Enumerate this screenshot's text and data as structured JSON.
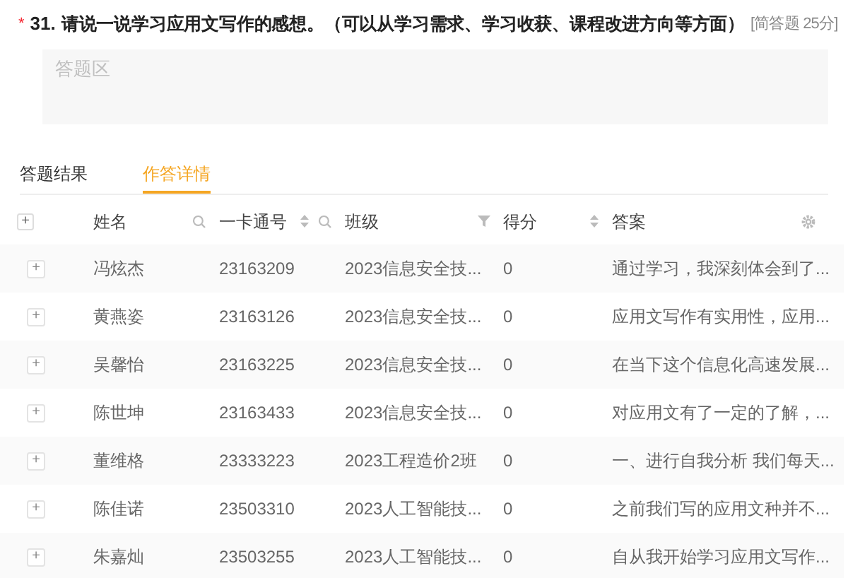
{
  "question": {
    "required_mark": "*",
    "number": "31.",
    "text": "请说一说学习应用文写作的感想。（可以从学习需求、学习收获、课程改进方向等方面）",
    "meta": "[简答题 25分]"
  },
  "answer_box": {
    "placeholder": "答题区"
  },
  "tabs": [
    {
      "label": "答题结果",
      "selected": false
    },
    {
      "label": "作答详情",
      "selected": true
    }
  ],
  "table": {
    "expand_all": "+",
    "columns": [
      {
        "label": "姓名",
        "kind": "search"
      },
      {
        "label": "一卡通号",
        "kind": "sort-search"
      },
      {
        "label": "班级",
        "kind": "filter"
      },
      {
        "label": "得分",
        "kind": "sort"
      },
      {
        "label": "答案",
        "kind": "settings"
      }
    ],
    "rows": [
      {
        "expand": "+",
        "cells": [
          "冯炫杰",
          "23163209",
          "2023信息安全技...",
          "0",
          "通过学习，我深刻体会到了..."
        ]
      },
      {
        "expand": "+",
        "cells": [
          "黄燕姿",
          "23163126",
          "2023信息安全技...",
          "0",
          "应用文写作有实用性，应用..."
        ]
      },
      {
        "expand": "+",
        "cells": [
          "吴馨怡",
          "23163225",
          "2023信息安全技...",
          "0",
          "在当下这个信息化高速发展..."
        ]
      },
      {
        "expand": "+",
        "cells": [
          "陈世坤",
          "23163433",
          "2023信息安全技...",
          "0",
          "对应用文有了一定的了解，..."
        ]
      },
      {
        "expand": "+",
        "cells": [
          "董维格",
          "23333223",
          "2023工程造价2班",
          "0",
          "一、进行自我分析 我们每天..."
        ]
      },
      {
        "expand": "+",
        "cells": [
          "陈佳诺",
          "23503310",
          "2023人工智能技...",
          "0",
          "之前我们写的应用文种并不..."
        ]
      },
      {
        "expand": "+",
        "cells": [
          "朱嘉灿",
          "23503255",
          "2023人工智能技...",
          "0",
          "自从我开始学习应用文写作..."
        ]
      }
    ]
  }
}
